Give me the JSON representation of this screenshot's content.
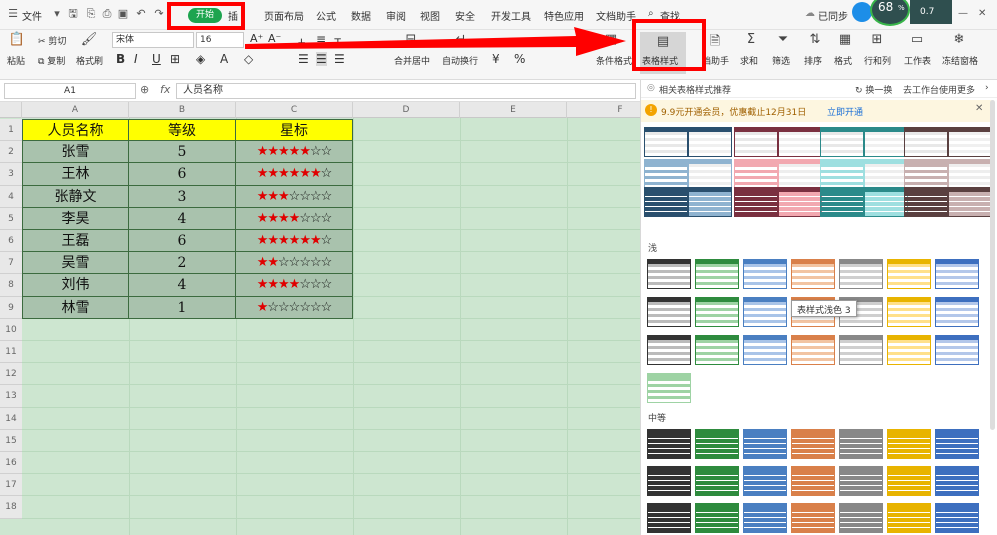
{
  "menubar": {
    "file": "文件",
    "start": "开始",
    "insert": "插",
    "tabs": [
      "页面布局",
      "公式",
      "数据",
      "审阅",
      "视图",
      "安全",
      "开发工具",
      "特色应用",
      "文档助手"
    ],
    "search": "查找",
    "sync": "已同步",
    "meter_pct": "68",
    "meter_unit": "%",
    "meter_speed": "0.7"
  },
  "ribbon": {
    "paste": "粘贴",
    "cut": "剪切",
    "copy": "复制",
    "format_painter": "格式刷",
    "font": "宋体",
    "size": "16",
    "merge": "合并居中",
    "wrap": "自动换行",
    "percent": "%",
    "cond_format": "条件格式",
    "table_style": "表格样式",
    "doc_helper": "档助手",
    "sum": "求和",
    "filter": "筛选",
    "sort": "排序",
    "format": "格式",
    "rowcol": "行和列",
    "worksheet": "工作表",
    "freeze": "冻结窗格"
  },
  "formula": {
    "cell_ref": "A1",
    "fx": "fx",
    "value": "人员名称"
  },
  "columns": [
    "A",
    "B",
    "C",
    "D",
    "E",
    "F"
  ],
  "rows": [
    "1",
    "2",
    "3",
    "4",
    "5",
    "6",
    "7",
    "8",
    "9",
    "10",
    "11",
    "12",
    "13",
    "14",
    "15",
    "16",
    "17",
    "18"
  ],
  "table": {
    "headers": [
      "人员名称",
      "等级",
      "星标"
    ],
    "data": [
      {
        "name": "张雪",
        "level": "5",
        "filled": "★★★★★",
        "empty": "☆☆"
      },
      {
        "name": "王林",
        "level": "6",
        "filled": "★★★★★★",
        "empty": "☆"
      },
      {
        "name": "张静文",
        "level": "3",
        "filled": "★★★",
        "empty": "☆☆☆☆"
      },
      {
        "name": "李昊",
        "level": "4",
        "filled": "★★★★",
        "empty": "☆☆☆"
      },
      {
        "name": "王磊",
        "level": "6",
        "filled": "★★★★★★",
        "empty": "☆"
      },
      {
        "name": "吴雪",
        "level": "2",
        "filled": "★★",
        "empty": "☆☆☆☆☆"
      },
      {
        "name": "刘伟",
        "level": "4",
        "filled": "★★★★",
        "empty": "☆☆☆"
      },
      {
        "name": "林雪",
        "level": "1",
        "filled": "★",
        "empty": "☆☆☆☆☆☆"
      }
    ]
  },
  "panel": {
    "recommend": "相关表格样式推荐",
    "swap": "换一换",
    "use_more": "去工作台使用更多",
    "promo_text": "9.9元开通会员，优惠截止12月31日",
    "promo_link": "立即开通",
    "light": "浅",
    "medium": "中等",
    "tooltip": "表样式浅色 3",
    "palette": {
      "dark": [
        "#333333",
        "#2e8b3e",
        "#4a7fc1",
        "#d9804a",
        "#888888",
        "#e8b400",
        "#3d6fbf",
        "#6aa84f"
      ],
      "light": [
        "#bbbbbb",
        "#9ed3a4",
        "#a9c4e8",
        "#f2c4a2",
        "#cfcfcf",
        "#ffe08a",
        "#b3c7ea",
        "#c6e0b4"
      ]
    }
  }
}
